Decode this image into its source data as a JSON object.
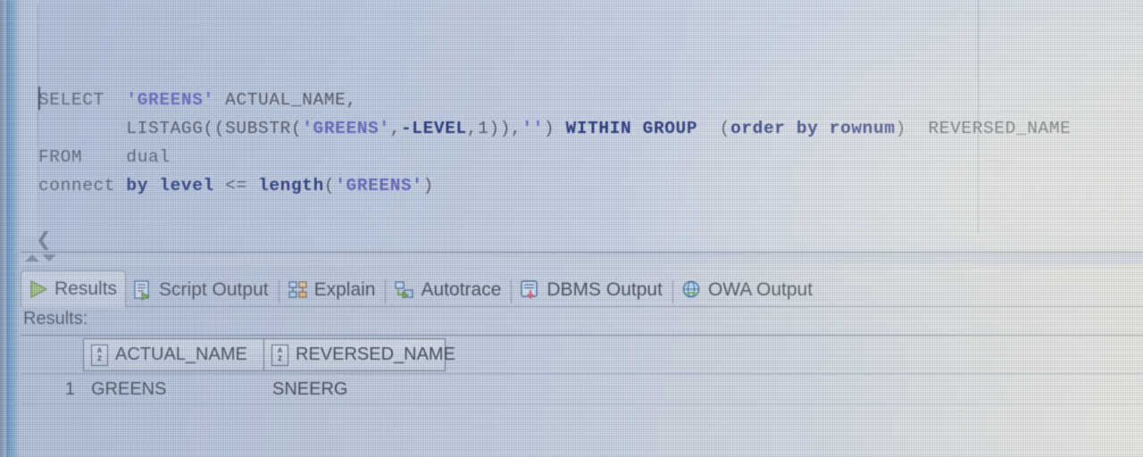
{
  "app": {
    "name": "Oracle SQL Developer",
    "worksheet": "SQL Worksheet"
  },
  "editor": {
    "caret_visible": true,
    "collapse_icon": "chevron-left-icon",
    "code_lines": [
      {
        "tokens": [
          {
            "t": "SELECT",
            "k": "plain"
          },
          {
            "t": "  ",
            "k": "plain"
          },
          {
            "t": "'GREENS'",
            "k": "str"
          },
          {
            "t": " ",
            "k": "plain"
          },
          {
            "t": "ACTUAL_NAME,",
            "k": "ident"
          }
        ]
      },
      {
        "tokens": [
          {
            "t": "        LISTAGG((SUBSTR(",
            "k": "ident"
          },
          {
            "t": "'GREENS'",
            "k": "str"
          },
          {
            "t": ",",
            "k": "punct"
          },
          {
            "t": "-LEVEL",
            "k": "kw"
          },
          {
            "t": ",1)),",
            "k": "punct"
          },
          {
            "t": "''",
            "k": "str"
          },
          {
            "t": ") ",
            "k": "punct"
          },
          {
            "t": "WITHIN GROUP",
            "k": "kw"
          },
          {
            "t": "  (",
            "k": "punct"
          },
          {
            "t": "order by rownum",
            "k": "kw"
          },
          {
            "t": ")  ",
            "k": "punct"
          },
          {
            "t": "REVERSED_NAME",
            "k": "ident"
          }
        ]
      },
      {
        "tokens": [
          {
            "t": "FROM    dual",
            "k": "plain"
          }
        ]
      },
      {
        "tokens": [
          {
            "t": "connect ",
            "k": "plain"
          },
          {
            "t": "by level",
            "k": "kw"
          },
          {
            "t": " <= ",
            "k": "punct"
          },
          {
            "t": "length",
            "k": "kw"
          },
          {
            "t": "(",
            "k": "punct"
          },
          {
            "t": "'GREENS'",
            "k": "str"
          },
          {
            "t": ")",
            "k": "punct"
          }
        ]
      }
    ]
  },
  "splitter": {
    "expand_icon": "triangle-up-icon",
    "collapse_icon": "triangle-down-icon"
  },
  "results_panel": {
    "tabs": [
      {
        "label": "Results",
        "icon": "green-play-icon",
        "active": true
      },
      {
        "label": "Script Output",
        "icon": "script-output-icon",
        "active": false
      },
      {
        "label": "Explain",
        "icon": "explain-plan-icon",
        "active": false
      },
      {
        "label": "Autotrace",
        "icon": "autotrace-icon",
        "active": false
      },
      {
        "label": "DBMS Output",
        "icon": "dbms-output-icon",
        "active": false
      },
      {
        "label": "OWA Output",
        "icon": "owa-output-icon",
        "active": false
      }
    ],
    "results_label": "Results:",
    "grid": {
      "columns": [
        {
          "name": "ACTUAL_NAME",
          "sort_icon": "az-sort-icon"
        },
        {
          "name": "REVERSED_NAME",
          "sort_icon": "az-sort-icon"
        }
      ],
      "rows": [
        {
          "num": "1",
          "ACTUAL_NAME": "GREENS",
          "REVERSED_NAME": "SNEERG"
        }
      ]
    }
  },
  "colors": {
    "keyword": "#16256e",
    "string": "#5b58b8",
    "identifier": "#3f444b",
    "play_icon": "#8cb54a",
    "editor_bg": "#c8d2e1",
    "panel_bg": "#c9d2df"
  }
}
